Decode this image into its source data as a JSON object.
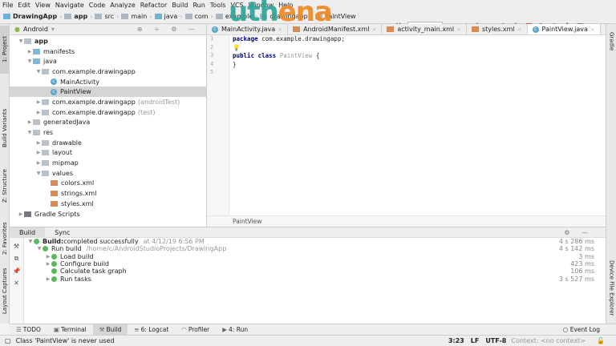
{
  "menu": [
    "File",
    "Edit",
    "View",
    "Navigate",
    "Code",
    "Analyze",
    "Refactor",
    "Build",
    "Run",
    "Tools",
    "VCS",
    "Window",
    "Help"
  ],
  "breadcrumbs": [
    "DrawingApp",
    "app",
    "src",
    "main",
    "java",
    "com",
    "example",
    "drawingapp",
    "PaintView"
  ],
  "logo": {
    "text": "uthena",
    "colors": [
      "#2fa59a",
      "#f08a24"
    ]
  },
  "run_config": "app",
  "project": {
    "view": "Android",
    "tree": [
      {
        "label": "app",
        "depth": 0,
        "arrow": "▼",
        "icon": "folder",
        "bold": true
      },
      {
        "label": "manifests",
        "depth": 1,
        "arrow": "▶",
        "icon": "bluefolder"
      },
      {
        "label": "java",
        "depth": 1,
        "arrow": "▼",
        "icon": "bluefolder"
      },
      {
        "label": "com.example.drawingapp",
        "depth": 2,
        "arrow": "▼",
        "icon": "folder"
      },
      {
        "label": "MainActivity",
        "depth": 3,
        "arrow": "",
        "icon": "cls"
      },
      {
        "label": "PaintView",
        "depth": 3,
        "arrow": "",
        "icon": "cls",
        "selected": true
      },
      {
        "label": "com.example.drawingapp",
        "suffix": "(androidTest)",
        "depth": 2,
        "arrow": "▶",
        "icon": "folder"
      },
      {
        "label": "com.example.drawingapp",
        "suffix": "(test)",
        "depth": 2,
        "arrow": "▶",
        "icon": "folder"
      },
      {
        "label": "generatedJava",
        "depth": 1,
        "arrow": "▶",
        "icon": "folder"
      },
      {
        "label": "res",
        "depth": 1,
        "arrow": "▼",
        "icon": "folder"
      },
      {
        "label": "drawable",
        "depth": 2,
        "arrow": "▶",
        "icon": "folder"
      },
      {
        "label": "layout",
        "depth": 2,
        "arrow": "▶",
        "icon": "folder"
      },
      {
        "label": "mipmap",
        "depth": 2,
        "arrow": "▶",
        "icon": "folder"
      },
      {
        "label": "values",
        "depth": 2,
        "arrow": "▼",
        "icon": "folder"
      },
      {
        "label": "colors.xml",
        "depth": 3,
        "arrow": "",
        "icon": "xml"
      },
      {
        "label": "strings.xml",
        "depth": 3,
        "arrow": "",
        "icon": "xml"
      },
      {
        "label": "styles.xml",
        "depth": 3,
        "arrow": "",
        "icon": "xml"
      },
      {
        "label": "Gradle Scripts",
        "depth": 0,
        "arrow": "▶",
        "icon": "gradle"
      }
    ]
  },
  "editor": {
    "tabs": [
      {
        "label": "MainActivity.java",
        "icon": "cls"
      },
      {
        "label": "AndroidManifest.xml",
        "icon": "xml"
      },
      {
        "label": "activity_main.xml",
        "icon": "xml"
      },
      {
        "label": "styles.xml",
        "icon": "xml"
      },
      {
        "label": "PaintView.java",
        "icon": "cls",
        "active": true
      }
    ],
    "line_numbers": [
      "1",
      "2",
      "3",
      "4",
      "5"
    ],
    "code": {
      "l1_kw": "package",
      "l1_rest": " com.example.drawingapp;",
      "l3_kw": "public class",
      "l3_name": "PaintView",
      "l3_rest": " {",
      "l4": "}"
    },
    "breadcrumb": "PaintView"
  },
  "left_stripe": [
    "1: Project",
    "Build Variants",
    "Z: Structure",
    "2: Favorites",
    "Layout Captures"
  ],
  "right_stripe": [
    "Gradle",
    "Device File Explorer"
  ],
  "build": {
    "tabs": [
      "Build",
      "Sync"
    ],
    "rows": [
      {
        "depth": 0,
        "arrow": "▼",
        "label": "Build:",
        "rest": " completed successfully",
        "note": "at 4/12/19 6:56 PM",
        "time": "4 s 286 ms"
      },
      {
        "depth": 1,
        "arrow": "▼",
        "label": "Run build",
        "note": "/home/c/AndroidStudioProjects/DrawingApp",
        "time": "4 s 142 ms"
      },
      {
        "depth": 2,
        "arrow": "▶",
        "label": "Load build",
        "time": "3 ms"
      },
      {
        "depth": 2,
        "arrow": "▶",
        "label": "Configure build",
        "time": "423 ms"
      },
      {
        "depth": 2,
        "arrow": "",
        "label": "Calculate task graph",
        "time": "106 ms"
      },
      {
        "depth": 2,
        "arrow": "▶",
        "label": "Run tasks",
        "time": "3 s 527 ms"
      }
    ]
  },
  "tool_windows": [
    "TODO",
    "Terminal",
    "Build",
    "6: Logcat",
    "Profiler",
    "4: Run"
  ],
  "event_log": "Event Log",
  "status": {
    "message": "Class 'PaintView' is never used",
    "position": "3:23",
    "line_sep": "LF",
    "encoding": "UTF-8",
    "context": "Context: <no context>"
  }
}
